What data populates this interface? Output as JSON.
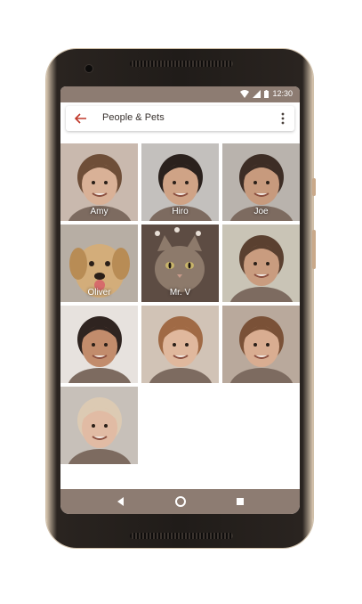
{
  "status_bar": {
    "time": "12:30",
    "icons": [
      "wifi-icon",
      "signal-icon",
      "battery-icon"
    ]
  },
  "app_bar": {
    "title": "People & Pets",
    "back_icon": "arrow-back-icon",
    "menu_icon": "more-vert-icon"
  },
  "people": [
    {
      "name": "Amy",
      "kind": "person",
      "bg": "#c9b9ae",
      "skin": "#d9b197",
      "hair": "#6e4e38"
    },
    {
      "name": "Hiro",
      "kind": "person",
      "bg": "#c3c0bd",
      "skin": "#cfa386",
      "hair": "#2a211d"
    },
    {
      "name": "Joe",
      "kind": "person",
      "bg": "#b9b3ad",
      "skin": "#c79a7d",
      "hair": "#3d2d25"
    },
    {
      "name": "Oliver",
      "kind": "dog",
      "bg": "#b7aea4",
      "fur": "#d3ad7a"
    },
    {
      "name": "Mr. V",
      "kind": "cat",
      "bg": "#5d4c43",
      "fur": "#8d7a6b"
    },
    {
      "name": "",
      "kind": "person",
      "bg": "#c9c4b6",
      "skin": "#c99c7f",
      "hair": "#5a4030"
    },
    {
      "name": "",
      "kind": "person",
      "bg": "#e7e2de",
      "skin": "#c28c6c",
      "hair": "#2f2420"
    },
    {
      "name": "",
      "kind": "person",
      "bg": "#d1c3b6",
      "skin": "#e0b89d",
      "hair": "#a06a45"
    },
    {
      "name": "",
      "kind": "person",
      "bg": "#b9a99c",
      "skin": "#d9ad91",
      "hair": "#7a5137"
    },
    {
      "name": "",
      "kind": "person",
      "bg": "#c7c0b9",
      "skin": "#e1bba4",
      "hair": "#dccab3"
    }
  ],
  "nav": {
    "back": "triangle-back-icon",
    "home": "circle-home-icon",
    "recents": "square-recents-icon"
  },
  "colors": {
    "status": "#8d7c72",
    "back_arrow": "#c0392b",
    "frame": "#201c19"
  }
}
